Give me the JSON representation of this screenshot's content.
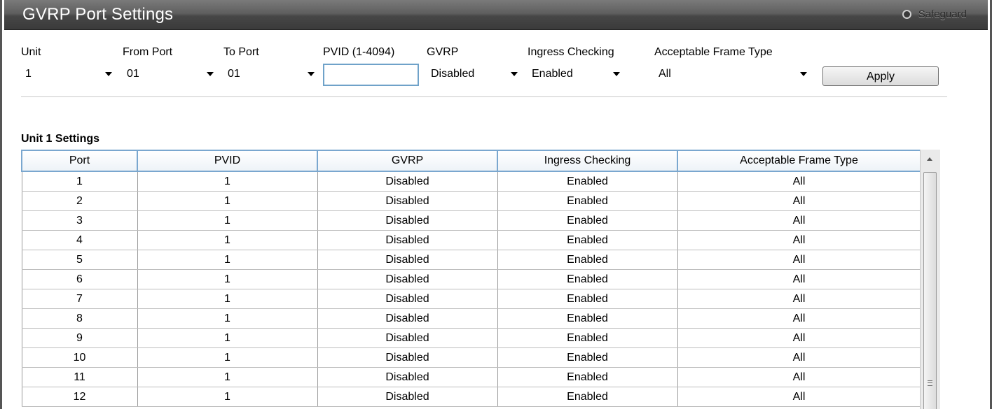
{
  "window": {
    "title": "GVRP Port Settings",
    "safeguard_label": "Safeguard"
  },
  "form": {
    "unit": {
      "label": "Unit",
      "value": "1"
    },
    "from_port": {
      "label": "From Port",
      "value": "01"
    },
    "to_port": {
      "label": "To Port",
      "value": "01"
    },
    "pvid": {
      "label": "PVID (1-4094)",
      "value": ""
    },
    "gvrp": {
      "label": "GVRP",
      "value": "Disabled"
    },
    "ingress": {
      "label": "Ingress Checking",
      "value": "Enabled"
    },
    "frame_type": {
      "label": "Acceptable Frame Type",
      "value": "All"
    },
    "apply_label": "Apply"
  },
  "table": {
    "section_title": "Unit 1 Settings",
    "columns": [
      "Port",
      "PVID",
      "GVRP",
      "Ingress Checking",
      "Acceptable Frame Type"
    ],
    "rows": [
      [
        "1",
        "1",
        "Disabled",
        "Enabled",
        "All"
      ],
      [
        "2",
        "1",
        "Disabled",
        "Enabled",
        "All"
      ],
      [
        "3",
        "1",
        "Disabled",
        "Enabled",
        "All"
      ],
      [
        "4",
        "1",
        "Disabled",
        "Enabled",
        "All"
      ],
      [
        "5",
        "1",
        "Disabled",
        "Enabled",
        "All"
      ],
      [
        "6",
        "1",
        "Disabled",
        "Enabled",
        "All"
      ],
      [
        "7",
        "1",
        "Disabled",
        "Enabled",
        "All"
      ],
      [
        "8",
        "1",
        "Disabled",
        "Enabled",
        "All"
      ],
      [
        "9",
        "1",
        "Disabled",
        "Enabled",
        "All"
      ],
      [
        "10",
        "1",
        "Disabled",
        "Enabled",
        "All"
      ],
      [
        "11",
        "1",
        "Disabled",
        "Enabled",
        "All"
      ],
      [
        "12",
        "1",
        "Disabled",
        "Enabled",
        "All"
      ]
    ]
  },
  "colors": {
    "title_bar": "#4a4a4a",
    "header_border": "#7aa7cf",
    "input_focus_border": "#6fa2c9"
  },
  "icons": {
    "safeguard": "safeguard-indicator-icon",
    "dropdown": "chevron-down-icon",
    "scroll_up": "scroll-up-arrow-icon"
  }
}
